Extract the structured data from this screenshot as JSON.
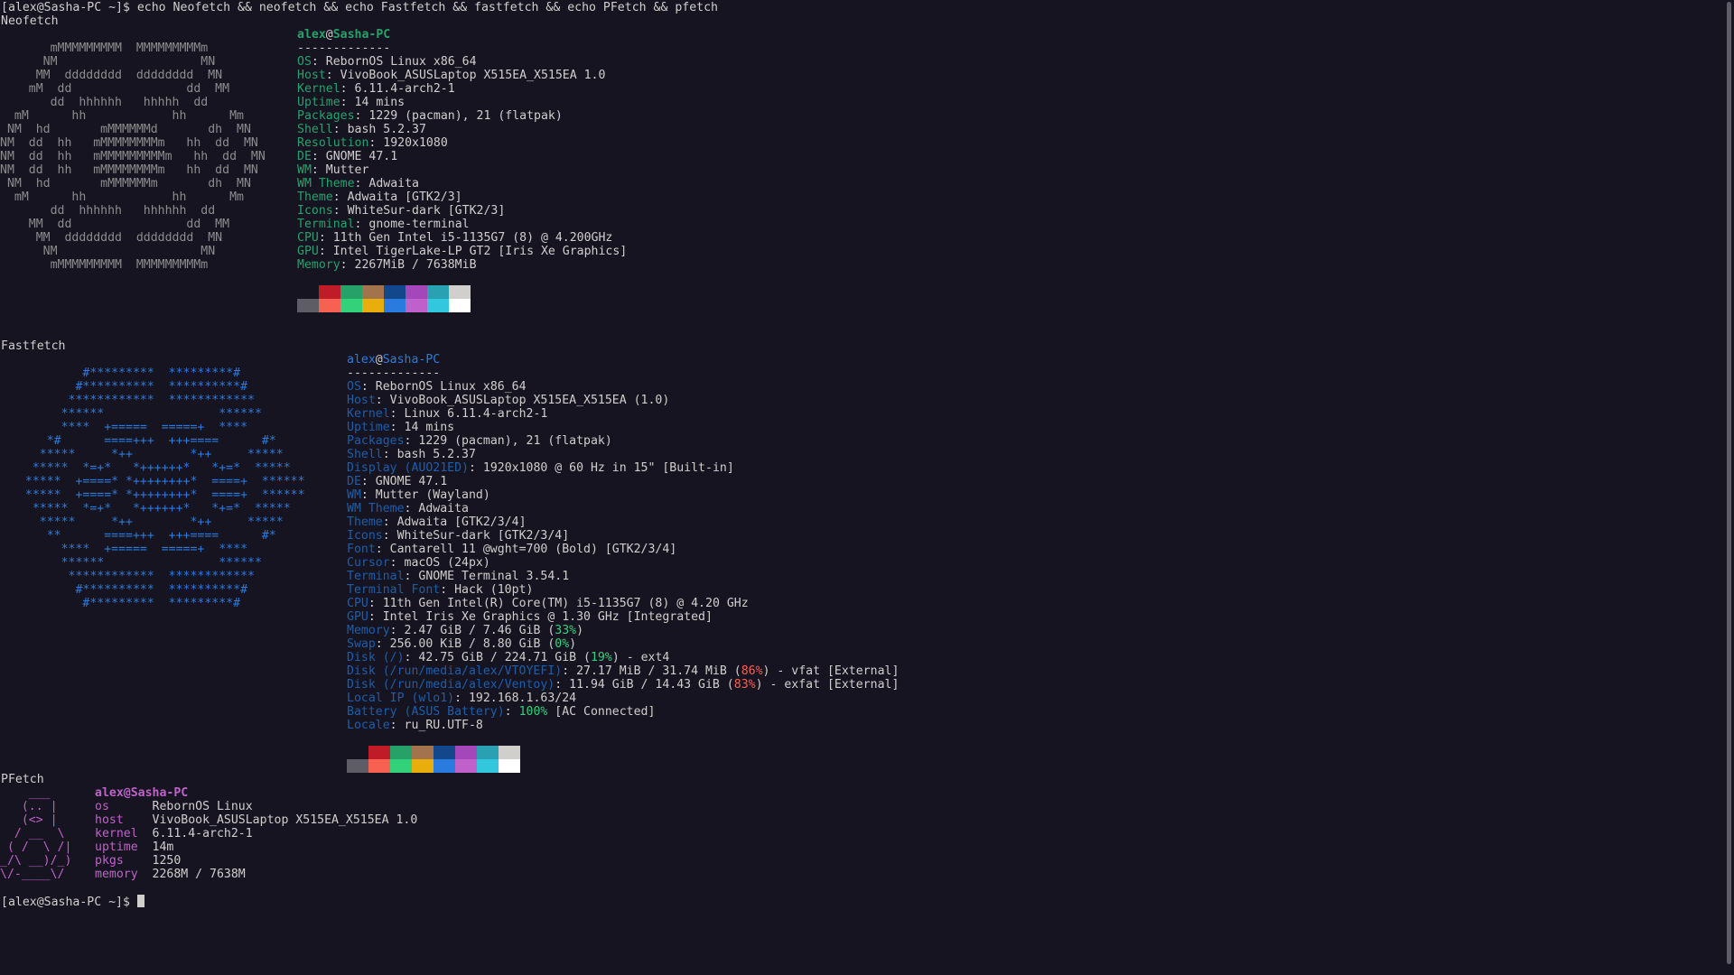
{
  "prompt": "[alex@Sasha-PC ~]$",
  "command": " echo Neofetch && neofetch && echo Fastfetch && fastfetch && echo PFetch && pfetch",
  "neofetch": {
    "heading": "Neofetch",
    "art": "       mMMMMMMMMM  MMMMMMMMMm\n      NM                    MN\n     MM  dddddddd  dddddddd  MN\n    mM  dd                dd  MM\n       dd  hhhhhh   hhhhh  dd\n  mM      hh            hh      Mm\n NM  hd       mMMMMMMd       dh  MN\nNM  dd  hh   mMMMMMMMMm   hh  dd  MN\nNM  dd  hh   mMMMMMMMMMm   hh  dd  MN\nNM  dd  hh   mMMMMMMMMm   hh  dd  MN\n NM  hd       mMMMMMMm       dh  MN\n  mM      hh            hh      Mm\n       dd  hhhhhh   hhhhhh  dd\n    MM  dd                dd  MM\n     MM  dddddddd  dddddddd  MN\n      NM                    MN\n       mMMMMMMMMM  MMMMMMMMMm",
    "user": "alex",
    "at": "@",
    "host": "Sasha-PC",
    "sep": "-------------",
    "items": [
      {
        "k": "OS",
        "v": "RebornOS Linux x86_64"
      },
      {
        "k": "Host",
        "v": "VivoBook_ASUSLaptop X515EA_X515EA 1.0"
      },
      {
        "k": "Kernel",
        "v": "6.11.4-arch2-1"
      },
      {
        "k": "Uptime",
        "v": "14 mins"
      },
      {
        "k": "Packages",
        "v": "1229 (pacman), 21 (flatpak)"
      },
      {
        "k": "Shell",
        "v": "bash 5.2.37"
      },
      {
        "k": "Resolution",
        "v": "1920x1080"
      },
      {
        "k": "DE",
        "v": "GNOME 47.1"
      },
      {
        "k": "WM",
        "v": "Mutter"
      },
      {
        "k": "WM Theme",
        "v": "Adwaita"
      },
      {
        "k": "Theme",
        "v": "Adwaita [GTK2/3]"
      },
      {
        "k": "Icons",
        "v": "WhiteSur-dark [GTK2/3]"
      },
      {
        "k": "Terminal",
        "v": "gnome-terminal"
      },
      {
        "k": "CPU",
        "v": "11th Gen Intel i5-1135G7 (8) @ 4.200GHz"
      },
      {
        "k": "GPU",
        "v": "Intel TigerLake-LP GT2 [Iris Xe Graphics]"
      },
      {
        "k": "Memory",
        "v": "2267MiB / 7638MiB"
      }
    ]
  },
  "fastfetch": {
    "heading": "Fastfetch",
    "art": "          #*********  *********#\n         #**********  **********#\n        ************  ************\n       ******                ******\n       ****  +=====  =====+  ****\n     *#      ====+++  +++====      #*\n    *****     *++        *++     *****\n   *****  *=+*   *++++++*   *+=*  *****\n  *****  +====* *++++++++*  ====+  ******\n  *****  +====* *++++++++*  ====+  ******\n   *****  *=+*   *++++++*   *+=*  *****\n    *****     *++        *++     *****\n     **      ====+++  +++====      #*\n       ****  +=====  =====+  ****\n       ******                ******\n        ************  ************\n         #**********  **********#\n          #*********  *********#",
    "user": "alex",
    "at": "@",
    "host": "Sasha-PC",
    "sep": "-------------",
    "items": [
      {
        "k": "OS",
        "v": "RebornOS Linux x86_64"
      },
      {
        "k": "Host",
        "v": "VivoBook_ASUSLaptop X515EA_X515EA (1.0)"
      },
      {
        "k": "Kernel",
        "v": "Linux 6.11.4-arch2-1"
      },
      {
        "k": "Uptime",
        "v": "14 mins"
      },
      {
        "k": "Packages",
        "v": "1229 (pacman), 21 (flatpak)"
      },
      {
        "k": "Shell",
        "v": "bash 5.2.37"
      },
      {
        "k": "Display (AUO21ED)",
        "v": "1920x1080 @ 60 Hz in 15\" [Built-in]"
      },
      {
        "k": "DE",
        "v": "GNOME 47.1"
      },
      {
        "k": "WM",
        "v": "Mutter (Wayland)"
      },
      {
        "k": "WM Theme",
        "v": "Adwaita"
      },
      {
        "k": "Theme",
        "v": "Adwaita [GTK2/3/4]"
      },
      {
        "k": "Icons",
        "v": "WhiteSur-dark [GTK2/3/4]"
      },
      {
        "k": "Font",
        "v": "Cantarell 11 @wght=700 (Bold) [GTK2/3/4]"
      },
      {
        "k": "Cursor",
        "v": "macOS (24px)"
      },
      {
        "k": "Terminal",
        "v": "GNOME Terminal 3.54.1"
      },
      {
        "k": "Terminal Font",
        "v": "Hack (10pt)"
      },
      {
        "k": "CPU",
        "v": "11th Gen Intel(R) Core(TM) i5-1135G7 (8) @ 4.20 GHz"
      },
      {
        "k": "GPU",
        "v": "Intel Iris Xe Graphics @ 1.30 GHz [Integrated]"
      },
      {
        "k": "Memory",
        "v": "2.47 GiB / 7.46 GiB (",
        "pct": "33%",
        "tail": ")"
      },
      {
        "k": "Swap",
        "v": "256.00 KiB / 8.80 GiB (",
        "pct": "0%",
        "tail": ")"
      },
      {
        "k": "Disk (/)",
        "v": "42.75 GiB / 224.71 GiB (",
        "pct": "19%",
        "tail": ") - ext4"
      },
      {
        "k": "Disk (/run/media/alex/VTOYEFI)",
        "v": "27.17 MiB / 31.74 MiB (",
        "pct": "86%",
        "pctColor": "red",
        "tail": ") - vfat [External]"
      },
      {
        "k": "Disk (/run/media/alex/Ventoy)",
        "v": "11.94 GiB / 14.43 GiB (",
        "pct": "83%",
        "pctColor": "red",
        "tail": ") - exfat [External]"
      },
      {
        "k": "Local IP (wlo1)",
        "v": "192.168.1.63/24"
      },
      {
        "k": "Battery (ASUS Battery)",
        "v": "",
        "pct": "100%",
        "tail": " [AC Connected]"
      },
      {
        "k": "Locale",
        "v": "ru_RU.UTF-8"
      }
    ]
  },
  "pfetch": {
    "heading": "PFetch",
    "art": "    ___\n   (.. |\n   (<> |\n  / __  \\\n ( /  \\ /|\n_/\\ __)/_)\n\\/-____\\/",
    "userline": "alex@Sasha-PC",
    "items": [
      {
        "k": "os",
        "v": "RebornOS Linux"
      },
      {
        "k": "host",
        "v": "VivoBook_ASUSLaptop X515EA_X515EA 1.0"
      },
      {
        "k": "kernel",
        "v": "6.11.4-arch2-1"
      },
      {
        "k": "uptime",
        "v": "14m"
      },
      {
        "k": "pkgs",
        "v": "1250"
      },
      {
        "k": "memory",
        "v": "2268M / 7638M"
      }
    ]
  },
  "palette": {
    "top": [
      "#171421",
      "#c01c28",
      "#26a269",
      "#a2734c",
      "#12488b",
      "#a347ba",
      "#2aa1b3",
      "#d0cfcc"
    ],
    "bottom": [
      "#5e5c64",
      "#f66151",
      "#33d17a",
      "#e9ad0c",
      "#2a7bde",
      "#c061cb",
      "#33c7de",
      "#ffffff"
    ]
  }
}
